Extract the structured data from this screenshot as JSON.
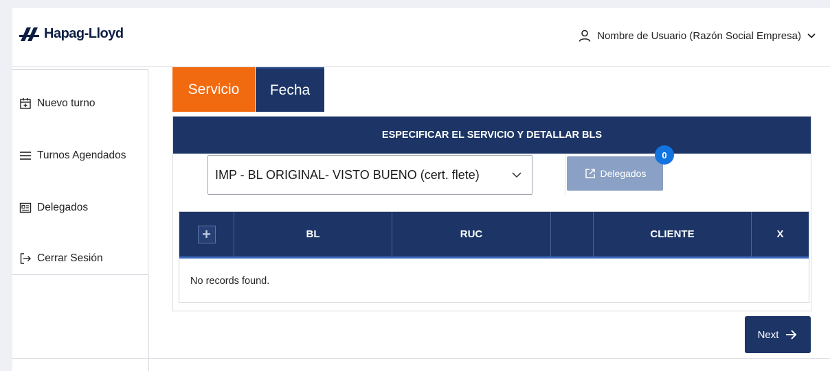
{
  "brand": {
    "name": "Hapag-Lloyd",
    "logo_icon": "hapag-lloyd-logo-icon"
  },
  "user": {
    "label": "Nombre de Usuario (Razón Social Empresa)",
    "icon": "user-icon"
  },
  "sidebar": {
    "items": [
      {
        "label": "Nuevo turno",
        "icon": "calendar-add-icon"
      },
      {
        "label": "Turnos Agendados",
        "icon": "menu-lines-icon"
      },
      {
        "label": "Delegados",
        "icon": "id-card-icon"
      },
      {
        "label": "Cerrar Sesión",
        "icon": "logout-icon"
      }
    ]
  },
  "tabs": [
    {
      "label": "Servicio",
      "active": true
    },
    {
      "label": "Fecha",
      "active": false
    }
  ],
  "panel": {
    "title": "ESPECIFICAR EL SERVICIO Y DETALLAR BLS",
    "service_select": {
      "value": "IMP - BL ORIGINAL- VISTO BUENO (cert. flete)"
    },
    "delegados_button": {
      "label": "Delegados",
      "badge": "0",
      "icon": "external-link-icon"
    },
    "table": {
      "columns": [
        "",
        "BL",
        "RUC",
        "",
        "CLIENTE",
        "X"
      ],
      "empty_message": "No records found."
    }
  },
  "next_button": {
    "label": "Next",
    "icon": "arrow-right-icon"
  },
  "colors": {
    "accent": "#f26a10",
    "navy": "#1c3566",
    "badge": "#1274e0",
    "disabled_button": "#8aa0c4"
  }
}
